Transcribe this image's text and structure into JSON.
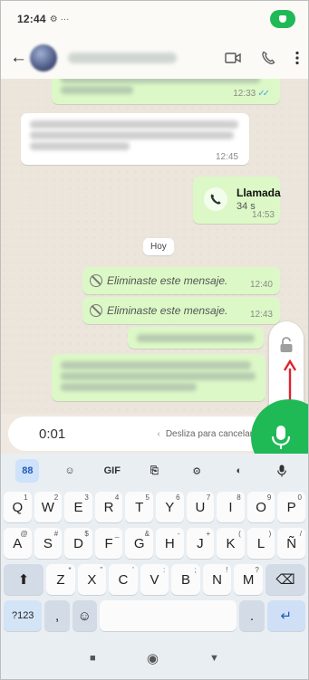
{
  "status": {
    "time": "12:44",
    "extra_icons": "⚙ ···"
  },
  "header": {
    "back_glyph": "←"
  },
  "chat": {
    "top_message_time": "12:33",
    "blurred_incoming_time": "12:45",
    "call": {
      "title": "Llamada",
      "duration": "34 s",
      "time": "14:53"
    },
    "date_chip": "Hoy",
    "deleted_messages": [
      {
        "text": "Eliminaste este mensaje.",
        "time": "12:40"
      },
      {
        "text": "Eliminaste este mensaje.",
        "time": "12:43"
      }
    ]
  },
  "recording": {
    "elapsed": "0:01",
    "slide_hint": "Desliza para cancelar",
    "slide_arrow": "‹"
  },
  "keyboard": {
    "toolbar": [
      "88",
      "☺",
      "GIF",
      "⎘",
      "⚙",
      "◐",
      "mic"
    ],
    "row1": [
      {
        "k": "Q",
        "s": "1"
      },
      {
        "k": "W",
        "s": "2"
      },
      {
        "k": "E",
        "s": "3"
      },
      {
        "k": "R",
        "s": "4"
      },
      {
        "k": "T",
        "s": "5"
      },
      {
        "k": "Y",
        "s": "6"
      },
      {
        "k": "U",
        "s": "7"
      },
      {
        "k": "I",
        "s": "8"
      },
      {
        "k": "O",
        "s": "9"
      },
      {
        "k": "P",
        "s": "0"
      }
    ],
    "row2": [
      {
        "k": "A",
        "s": "@"
      },
      {
        "k": "S",
        "s": "#"
      },
      {
        "k": "D",
        "s": "$"
      },
      {
        "k": "F",
        "s": "_"
      },
      {
        "k": "G",
        "s": "&"
      },
      {
        "k": "H",
        "s": "-"
      },
      {
        "k": "J",
        "s": "+"
      },
      {
        "k": "K",
        "s": "("
      },
      {
        "k": "L",
        "s": ")"
      },
      {
        "k": "Ñ",
        "s": "/"
      }
    ],
    "row3": [
      {
        "k": "Z",
        "s": "*"
      },
      {
        "k": "X",
        "s": "\""
      },
      {
        "k": "C",
        "s": "'"
      },
      {
        "k": "V",
        "s": ":"
      },
      {
        "k": "B",
        "s": ";"
      },
      {
        "k": "N",
        "s": "!"
      },
      {
        "k": "M",
        "s": "?"
      }
    ],
    "shift": "⬆",
    "backspace": "⌫",
    "symbols": "?123",
    "comma": ",",
    "emoji": "☺",
    "period": ".",
    "enter": "↵"
  },
  "nav": {
    "square": "■",
    "home": "◉",
    "back": "▼"
  }
}
